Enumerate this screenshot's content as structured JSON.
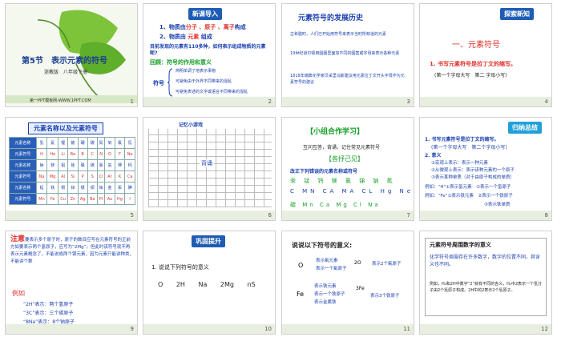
{
  "s1": {
    "num": "1",
    "title": "第5节　表示元素的符号",
    "sub": "浙教版　八年级下册",
    "footer": "第一PPT模板网-WWW.1PPT.COM"
  },
  "s2": {
    "num": "2",
    "tag": "新课导入",
    "l1_pre": "1、物质由",
    "l1_mid": "分子 、原子 、离子",
    "l1_suf": "构成",
    "l2_pre": "2、物质由",
    "l2_mid": " 元素 ",
    "l2_suf": "组成",
    "q": "目前发现的元素有110多种，如何表示组成物质的元素呢?",
    "review": "回顾：符号的作用和意义",
    "sym": "符号",
    "b1": "简明单调了地表示事物",
    "b2": "可避免由于外界不同带来的混乱",
    "b3": "可避免表述的文字或语言不同带来的混乱"
  },
  "s3": {
    "num": "3",
    "title": "元素符号的发展历史",
    "p1": "古希腊时，人们已开始用符号来表示当时所知道的元素",
    "p2": "19世纪道尔顿用圆圈里面加不同的图案或字母来表示各种元素",
    "p3": "1818年瑞典化学家贝采里乌斯建议用元素拉丁文开头字母作为元素符号的建议"
  },
  "s4": {
    "num": "4",
    "tag": "探索新知",
    "h1": "一、元素符号",
    "item": "1. 书写元素符号是拉丁文的缩写。",
    "note": "(第一个字母大写　第二 字母小写)"
  },
  "s5": {
    "num": "5",
    "title": "元素名称以及元素符号",
    "r1": [
      "元素名称",
      "氢",
      "氦",
      "锂",
      "铍",
      "硼",
      "碳",
      "氮",
      "氧",
      "氟",
      "氖"
    ],
    "r2": [
      "元素符号",
      "H",
      "He",
      "Li",
      "Be",
      "B",
      "C",
      "N",
      "O",
      "F",
      "Ne"
    ],
    "r3": [
      "元素名称",
      "钠",
      "镁",
      "铝",
      "硅",
      "磷",
      "硫",
      "氯",
      "氩",
      "钾",
      "钙"
    ],
    "r4": [
      "元素符号",
      "Na",
      "Mg",
      "Al",
      "Si",
      "P",
      "S",
      "Cl",
      "Ar",
      "K",
      "Ca"
    ],
    "r5": [
      "元素名称",
      "锰",
      "铁",
      "铜",
      "锌",
      "银",
      "钡",
      "铂",
      "金",
      "汞",
      "碘"
    ],
    "r6": [
      "元素符号",
      "Mn",
      "Fe",
      "Cu",
      "Zn",
      "Ag",
      "Ba",
      "Pt",
      "Au",
      "Hg",
      "I"
    ]
  },
  "s6": {
    "num": "6",
    "title": "记忆小游戏",
    "sub": "背诵"
  },
  "s7": {
    "num": "7",
    "title": "【小组合作学习】",
    "p1": "互问互答，背诵，记住常见元素符号",
    "sub": "【各抒己见】",
    "p2": "改正下列错误的元素名称或符号",
    "names": [
      "汞",
      "锰",
      "钙",
      "镁",
      "氯",
      "锑",
      "钠",
      "氮"
    ],
    "syms1": [
      "C",
      "MN",
      "CA",
      "MA",
      "CL",
      "Hg",
      "Ne"
    ],
    "names2": [
      "碳",
      "锰",
      "钙",
      "镁",
      "氯",
      "汞",
      "钠"
    ],
    "syms2": [
      "Mn",
      "Ca",
      "Mg",
      "Cl",
      "Na"
    ]
  },
  "s8": {
    "num": "8",
    "tag": "归纳总结",
    "l1": "1. 书写元素符号是拉丁文的缩写。",
    "l1b": "(第一个字母大写　第二个字母小写)",
    "l2": "2. 意义",
    "a1": "①宏观上表示：表示一种元素",
    "a2": "②从微观上表示：表示该种元素的一个原子",
    "a3": "③表示某种单质（对于由原子构成的单质）",
    "ex1": "例如：“H”①表示氢元素　②表示一个氢原子",
    "ex2": "例如：“Fe”①表示铁元素　②表示一个铁原子",
    "ex3": "③表示铁单质"
  },
  "s9": {
    "num": "9",
    "lead": "注意",
    "p": "要表示多个原子时，原子的数目应写在元素符号的正前方如要表示两个氢原子，应写为“2Mg”。但此时该符号就不再表示元素概念了，不能说成两个镁元素，因为元素只能讲种类，不能讲个数",
    "ex": "例如",
    "e1": "“2H”表示：两个氢原子",
    "e2": "“3C”表示：三个碳原子",
    "e3": "“8Na”表示：8个钠原子"
  },
  "s10": {
    "num": "10",
    "tag": "巩固提升",
    "q": "1. 说说下列符号的意义",
    "syms": [
      "O",
      "2H",
      "Na",
      "2Mg",
      "nS"
    ]
  },
  "s11": {
    "num": "11",
    "title": "说说以下符号的意义:",
    "o": "O",
    "o1": "表示氧元素",
    "o2": "表示一个氧原子",
    "o3": "2O",
    "o3b": "表示2个氧原子",
    "fe": "Fe",
    "f1": "表示铁元素",
    "f2": "表示一个铁原子",
    "f3": "表示金属铁",
    "f4": "3Fe",
    "f4b": "表示3个铁原子"
  },
  "s12": {
    "num": "12",
    "title": "元素符号周围数字的意义",
    "p1": "化学符号周围存在许多数字，数字的位置不同，其含义也不同。",
    "p2": "例如，H₂和2H中数字“2”就有不同的含义，H₂中2表示一个氢分子由2个氢原子构成。2H中的2表示2个氢原子。"
  }
}
